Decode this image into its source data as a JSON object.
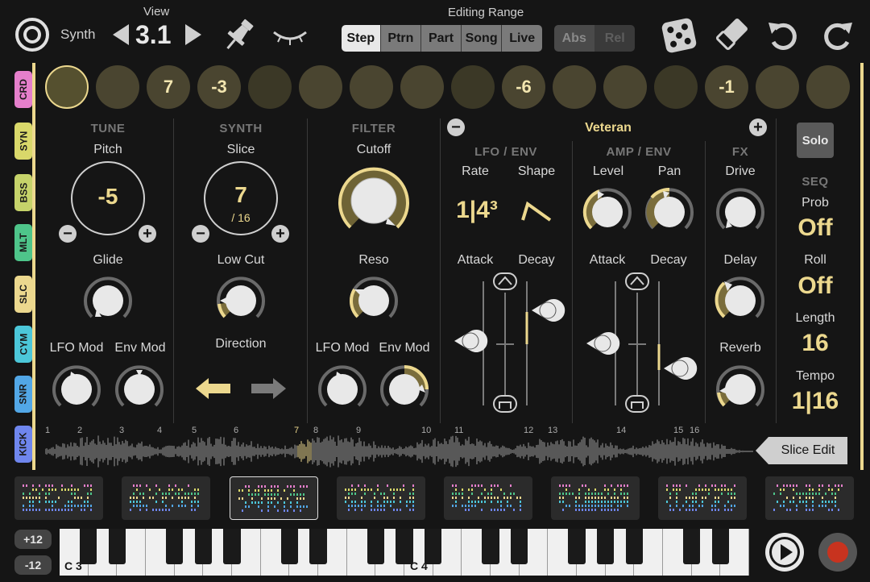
{
  "header": {
    "instrument": "Synth",
    "view_label": "View",
    "view_value": "3.1",
    "editing_range_label": "Editing Range",
    "range_buttons": [
      "Step",
      "Ptrn",
      "Part",
      "Song",
      "Live"
    ],
    "range_selected": "Step",
    "mode_buttons": [
      "Abs",
      "Rel"
    ]
  },
  "steps": [
    "",
    "",
    "7",
    "-3",
    "",
    "",
    "",
    "",
    "",
    "-6",
    "",
    "",
    "",
    "-1",
    "",
    ""
  ],
  "tracks": [
    {
      "label": "CRD",
      "color": "#e57fcb"
    },
    {
      "label": "SYN",
      "color": "#d9d86a"
    },
    {
      "label": "BSS",
      "color": "#c6d36a"
    },
    {
      "label": "MLT",
      "color": "#4ec58a"
    },
    {
      "label": "SLC",
      "color": "#ecd88e"
    },
    {
      "label": "CYM",
      "color": "#4cc7d9"
    },
    {
      "label": "SNR",
      "color": "#52a7e6"
    },
    {
      "label": "KICK",
      "color": "#6f86ee"
    }
  ],
  "tune": {
    "header": "TUNE",
    "pitch_label": "Pitch",
    "pitch_value": "-5",
    "glide_label": "Glide",
    "lfo_mod_label": "LFO Mod",
    "env_mod_label": "Env Mod"
  },
  "synth": {
    "header": "SYNTH",
    "slice_label": "Slice",
    "slice_value": "7",
    "slice_total": "/ 16",
    "low_cut_label": "Low Cut",
    "direction_label": "Direction"
  },
  "filter": {
    "header": "FILTER",
    "cutoff_label": "Cutoff",
    "reso_label": "Reso",
    "lfo_mod_label": "LFO Mod",
    "env_mod_label": "Env Mod"
  },
  "preset": {
    "name": "Veteran"
  },
  "lfo_env": {
    "header": "LFO / ENV",
    "rate_label": "Rate",
    "rate_value": "1|4³",
    "shape_label": "Shape",
    "attack_label": "Attack",
    "decay_label": "Decay"
  },
  "amp_env": {
    "header": "AMP / ENV",
    "level_label": "Level",
    "pan_label": "Pan",
    "attack_label": "Attack",
    "decay_label": "Decay"
  },
  "fx": {
    "header": "FX",
    "drive_label": "Drive",
    "delay_label": "Delay",
    "reverb_label": "Reverb"
  },
  "seq": {
    "solo_label": "Solo",
    "header": "SEQ",
    "prob_label": "Prob",
    "prob_value": "Off",
    "roll_label": "Roll",
    "roll_value": "Off",
    "length_label": "Length",
    "length_value": "16",
    "tempo_label": "Tempo",
    "tempo_value": "1|16"
  },
  "waveform": {
    "markers": [
      "1",
      "2",
      "3",
      "4",
      "5",
      "6",
      "7",
      "8",
      "9",
      "10",
      "11",
      "12",
      "13",
      "14",
      "15",
      "16"
    ],
    "selected_marker": "7",
    "slice_edit_label": "Slice Edit"
  },
  "keyboard": {
    "octave_up": "+12",
    "octave_down": "-12",
    "c3_label": "C 3",
    "c4_label": "C 4"
  },
  "colors": {
    "accent": "#ecd88e",
    "background": "#151515",
    "record": "#c8331f"
  }
}
